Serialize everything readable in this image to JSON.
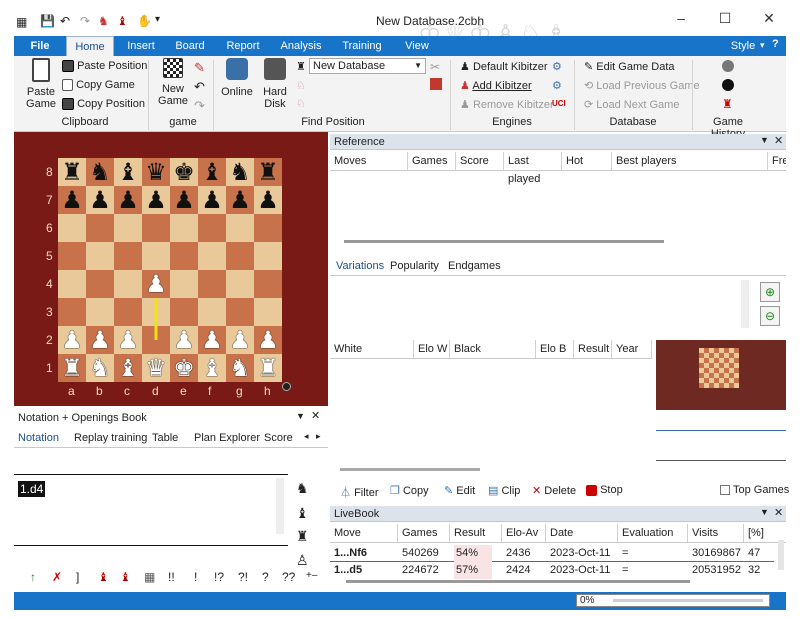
{
  "window": {
    "title": "New Database.2cbh",
    "minimize": "–",
    "maximize": "☐",
    "close": "✕"
  },
  "tabs": {
    "file": "File",
    "home": "Home",
    "insert": "Insert",
    "board": "Board",
    "report": "Report",
    "analysis": "Analysis",
    "training": "Training",
    "view": "View",
    "style": "Style"
  },
  "ribbon": {
    "paste_game": [
      "Paste",
      "Game"
    ],
    "paste_position": "Paste Position",
    "copy_game": "Copy Game",
    "copy_position": "Copy Position",
    "clipboard": "Clipboard",
    "new_game": [
      "New",
      "Game"
    ],
    "game": "game",
    "online": "Online",
    "hard_disk": [
      "Hard",
      "Disk"
    ],
    "database_select": "New Database",
    "find_position": "Find Position",
    "default_kibitzer": "Default Kibitzer",
    "add_kibitzer": "Add Kibitzer",
    "remove_kibitzer": "Remove Kibitzer",
    "engines": "Engines",
    "edit_game_data": "Edit Game Data",
    "load_previous_game": "Load Previous Game",
    "load_next_game": "Load Next Game",
    "database": "Database",
    "game_history": "Game History"
  },
  "reference": {
    "title": "Reference",
    "cols": [
      "Moves",
      "Games",
      "Score",
      "Last played",
      "Hot",
      "Best players",
      "Freq"
    ]
  },
  "variations": {
    "tabs": [
      "Variations",
      "Popularity",
      "Endgames"
    ]
  },
  "games": {
    "cols": [
      "White",
      "Elo W",
      "Black",
      "Elo B",
      "Result",
      "Year"
    ]
  },
  "toolbar": {
    "filter": "Filter",
    "copy": "Copy",
    "edit": "Edit",
    "clip": "Clip",
    "delete": "Delete",
    "stop": "Stop",
    "top_games": "Top Games"
  },
  "notation": {
    "title": "Notation + Openings Book",
    "tabs": [
      "Notation",
      "Replay training",
      "Table",
      "Plan Explorer",
      "Score"
    ],
    "move": "1.d4",
    "symbols": [
      "!!",
      "!",
      "!?",
      "?!",
      "?",
      "??",
      "+–"
    ]
  },
  "board": {
    "files": [
      "a",
      "b",
      "c",
      "d",
      "e",
      "f",
      "g",
      "h"
    ],
    "ranks": [
      "8",
      "7",
      "6",
      "5",
      "4",
      "3",
      "2",
      "1"
    ],
    "position": [
      "rnbqkbnr",
      "pppppppp",
      "........",
      "........",
      "...P....",
      "........",
      "PPP.PPPP",
      "RNBQKBNR"
    ],
    "arrow": {
      "from": "d2",
      "to": "d4",
      "color": "#f4e01a"
    }
  },
  "livebook": {
    "title": "LiveBook",
    "cols": [
      "Move",
      "Games",
      "Result",
      "Elo-Av",
      "Date",
      "Evaluation",
      "Visits",
      "[%]"
    ],
    "rows": [
      [
        "1...Nf6",
        "540269",
        "54%",
        "2436",
        "2023-Oct-11",
        "=",
        "30169867",
        "47"
      ],
      [
        "1...d5",
        "224672",
        "57%",
        "2424",
        "2023-Oct-11",
        "=",
        "20531952",
        "32"
      ]
    ]
  },
  "status": {
    "progress": "0%"
  }
}
